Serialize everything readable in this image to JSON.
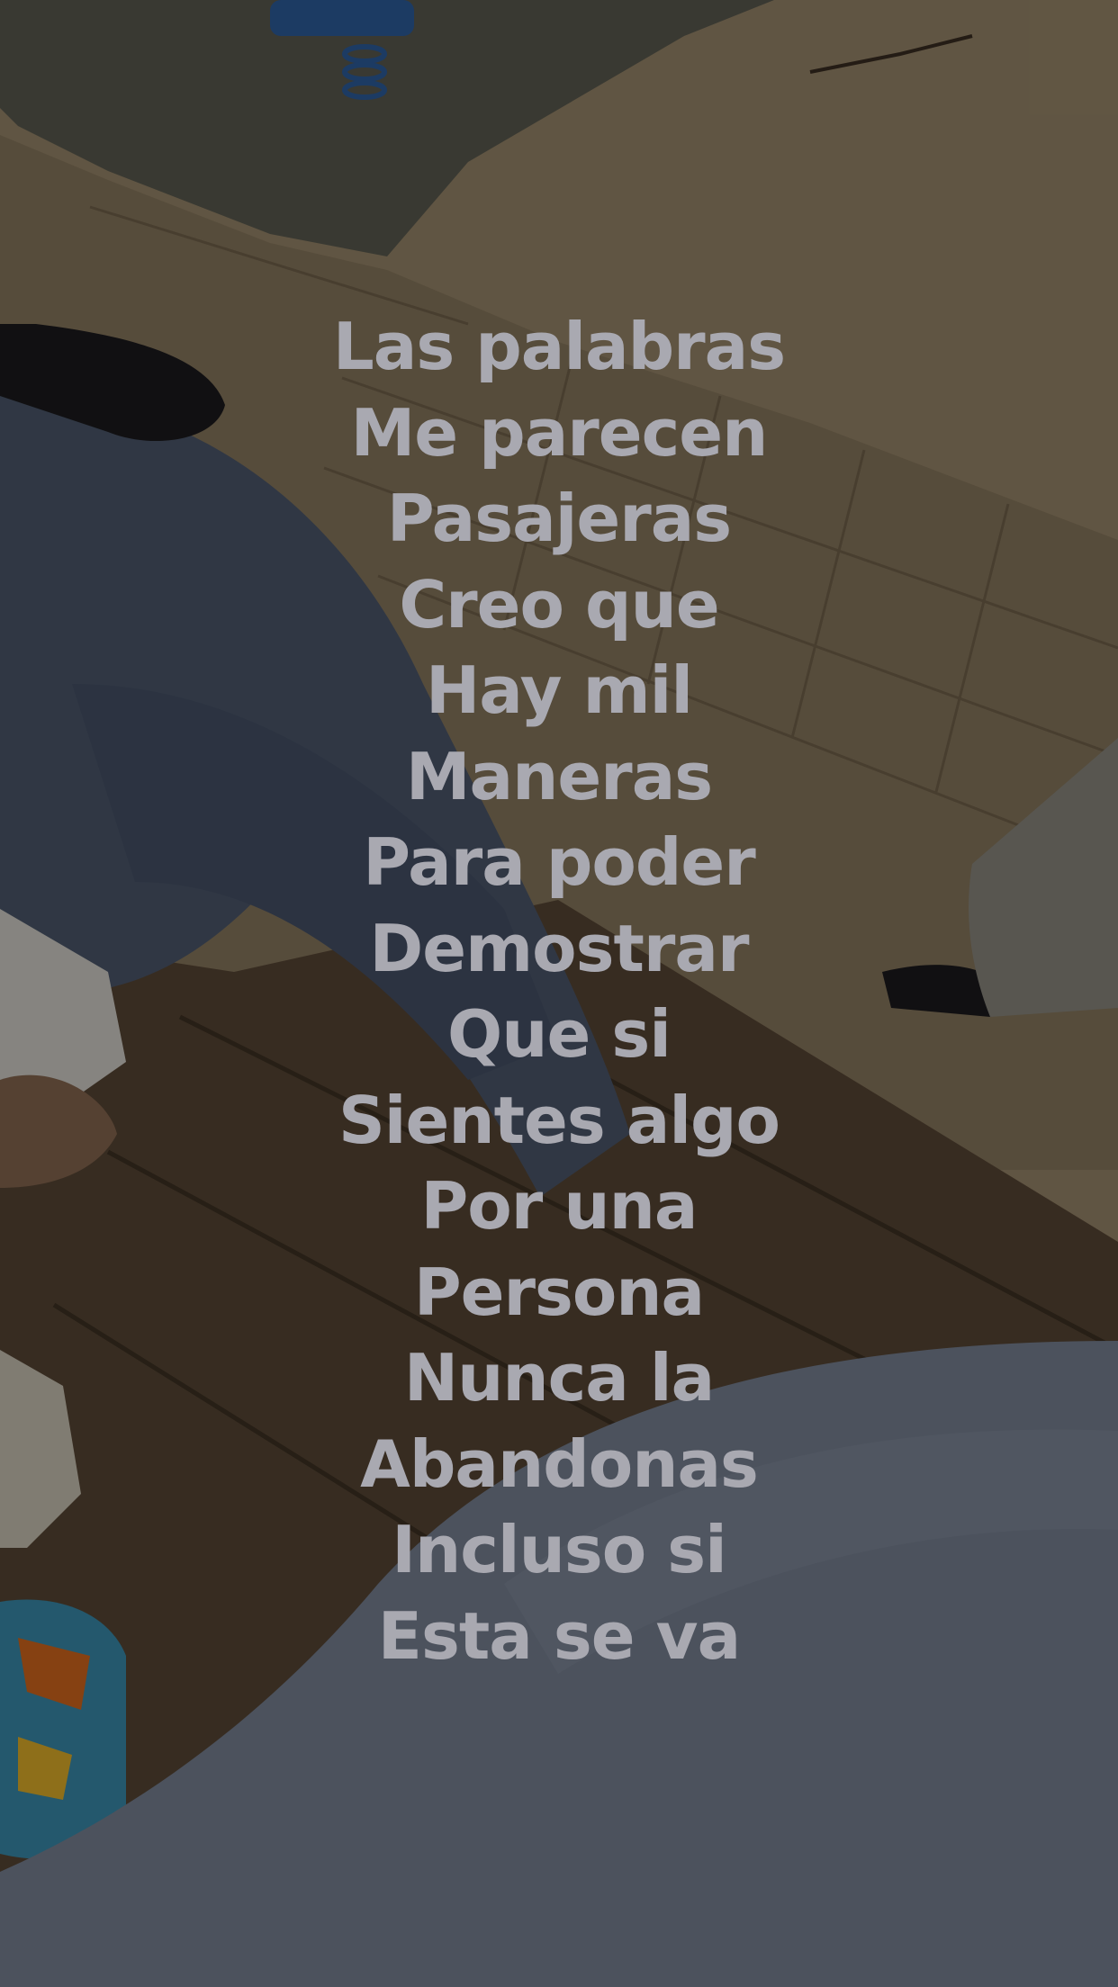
{
  "overlay_text": {
    "lines": [
      "Las palabras",
      "Me parecen",
      "Pasajeras",
      "Creo que",
      "Hay mil",
      "Maneras",
      "Para poder",
      "Demostrar",
      "Que si",
      "Sientes algo",
      "Por una",
      "Persona",
      "Nunca la",
      "Abandonas",
      "Incluso si",
      "Esta se va"
    ],
    "color": "#a9a9b1"
  },
  "background_photo": {
    "description_icon": "photo-background-icon",
    "palette": {
      "pavement": "#8f7d62",
      "tan_surface": "#9c8a6c",
      "grey_surface": "#55554c",
      "wood": "#5a4836",
      "denim": "#4e5a6e",
      "light_denim": "#7b8597"
    }
  }
}
